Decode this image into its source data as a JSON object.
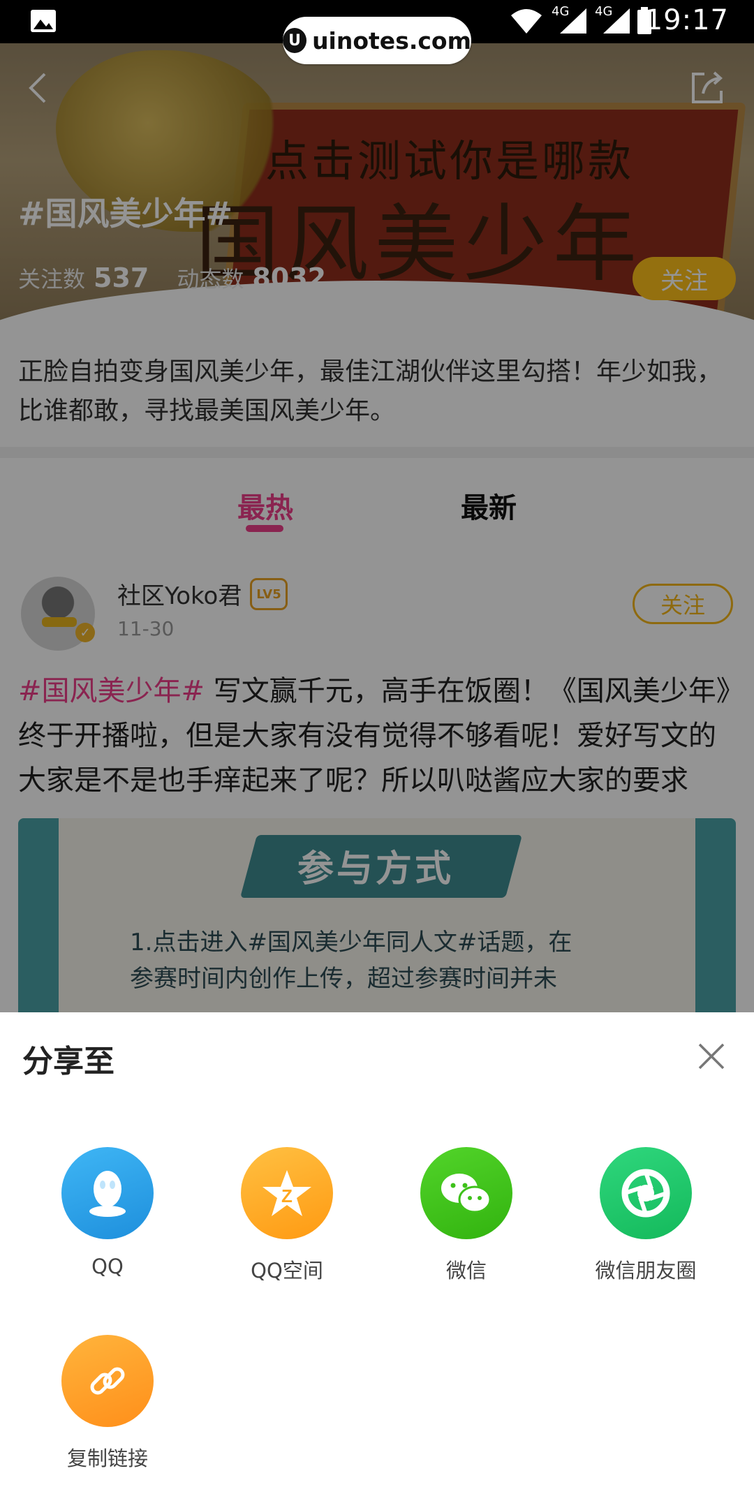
{
  "status_bar": {
    "time": "19:17",
    "network_1": "4G",
    "network_2": "4G"
  },
  "watermark": {
    "text": "uinotes.com",
    "logo": "U"
  },
  "topic": {
    "title": "#国风美少年#",
    "banner_text_small": "点击测试你是哪款",
    "banner_text_big": "国风美少年",
    "followers_label": "关注数",
    "followers_count": "537",
    "posts_label": "动态数",
    "posts_count": "8032",
    "follow_label": "关注",
    "description": "正脸自拍变身国风美少年，最佳江湖伙伴这里勾搭！年少如我，比谁都敢，寻找最美国风美少年。"
  },
  "tabs": [
    {
      "label": "最热",
      "active": true
    },
    {
      "label": "最新",
      "active": false
    }
  ],
  "post": {
    "username": "社区Yoko君",
    "level": "LV5",
    "date": "11-30",
    "follow_label": "关注",
    "hashtag": "#国风美少年#",
    "text": " 写文赢千元，高手在饭圈！《国风美少年》终于开播啦，但是大家有没有觉得不够看呢！爱好写文的大家是不是也手痒起来了呢？所以叭哒酱应大家的要求",
    "image_heading": "参与方式",
    "image_line1": "1.点击进入#国风美少年同人文#话题，在",
    "image_line2": "参赛时间内创作上传，超过参赛时间并未"
  },
  "share_sheet": {
    "title": "分享至",
    "options": [
      {
        "label": "QQ",
        "icon": "qq-icon",
        "color": "#2a9ee8"
      },
      {
        "label": "QQ空间",
        "icon": "qzone-icon",
        "color": "#ffa820"
      },
      {
        "label": "微信",
        "icon": "wechat-icon",
        "color": "#3ec11a"
      },
      {
        "label": "微信朋友圈",
        "icon": "moments-icon",
        "color": "#1ec66b"
      },
      {
        "label": "复制链接",
        "icon": "link-icon",
        "color": "#ff9c1e"
      }
    ]
  }
}
